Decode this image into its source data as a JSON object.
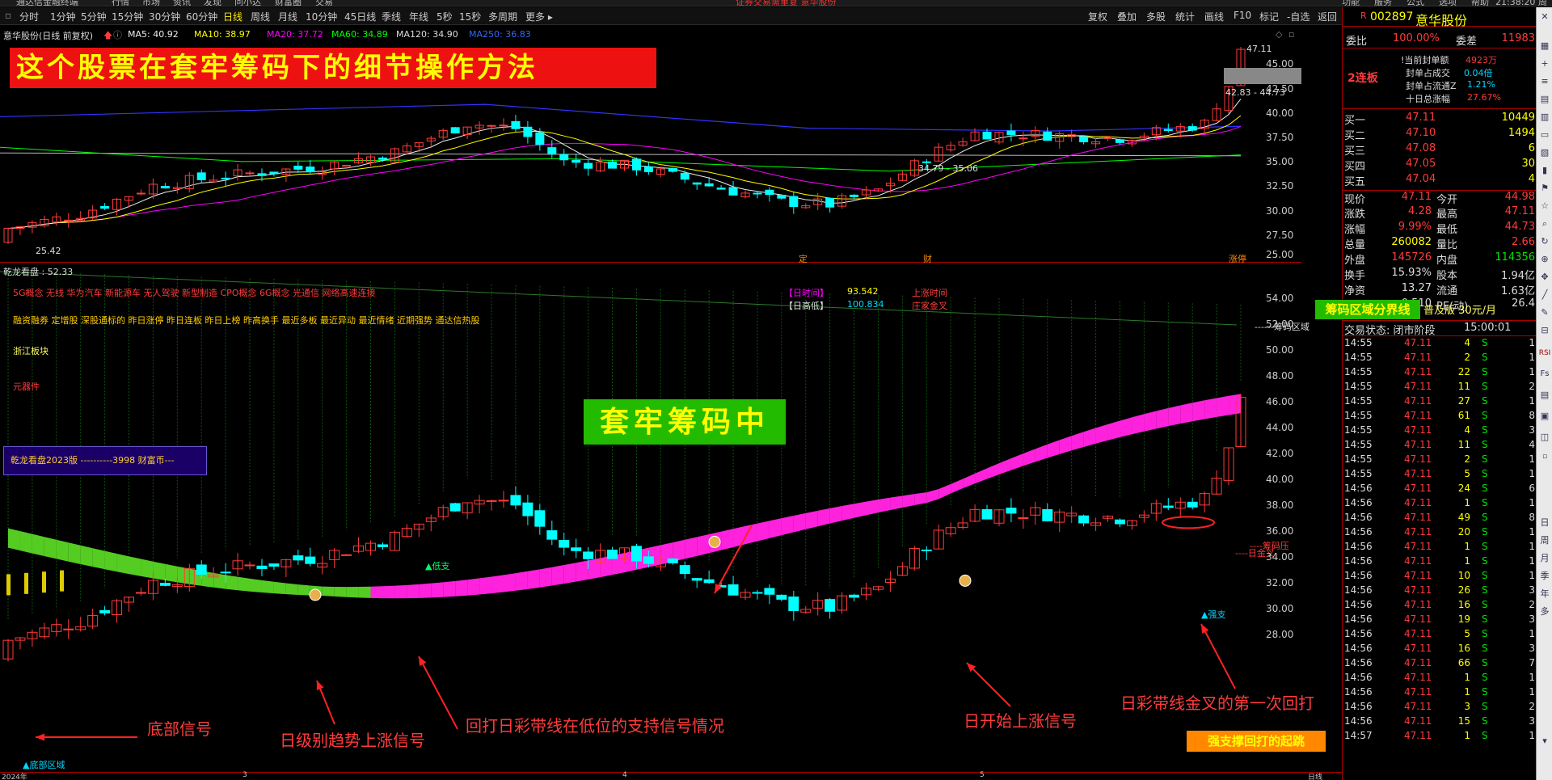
{
  "menubar": {
    "items": [
      "通达信金融终端",
      "行情",
      "市场",
      "资讯",
      "发现",
      "问小达",
      "财富圈",
      "交易"
    ],
    "notice": "证券交易需重复 意华股份",
    "right_items": [
      "功能",
      "服务",
      "公式",
      "选项",
      "帮助"
    ],
    "clock": "21:38:20 周六"
  },
  "toolbar": {
    "periods": [
      "分时",
      "1分钟",
      "5分钟",
      "15分钟",
      "30分钟",
      "60分钟",
      "日线",
      "周线",
      "月线",
      "10分钟",
      "45日线",
      "季线",
      "年线",
      "5秒",
      "15秒",
      "多周期",
      "更多 ▸"
    ],
    "active_period": "日线",
    "right_items": [
      "复权",
      "叠加",
      "多股",
      "统计",
      "画线",
      "F10",
      "标记",
      "-自选",
      "返回"
    ]
  },
  "chart_header": {
    "name": "意华股份(日线 前复权)",
    "ma5": "MA5: 40.92",
    "ma10": "MA10: 38.97",
    "ma20": "MA20: 37.72",
    "ma60": "MA60: 34.89",
    "ma120": "MA120: 34.90",
    "ma250": "MA250: 36.83"
  },
  "banner_top": "这个股票在套牢筹码下的细节操作方法",
  "main_labels": {
    "low": "25.42",
    "high": "47.11",
    "range1": "42.83 - 44.73",
    "range2": "34.79 - 35.06",
    "tag_ding": "定",
    "tag_cai": "财",
    "tag_zhang": "涨停"
  },
  "main_axis": [
    "45.00",
    "42.50",
    "40.00",
    "37.50",
    "35.00",
    "32.50",
    "30.00",
    "27.50",
    "25.00"
  ],
  "indicator": {
    "title": "乾龙看盘 : 52.33",
    "concept_line1": "5G概念 无线 华为汽车 新能源车 无人驾驶 新型制造 CPO概念 6G概念 光通信 网络高速连接",
    "concept_line2": "融资融券 定增股 深股通标的 昨日涨停 昨日连板 昨日上榜 昨高换手 最近多板 最近异动 最近情绪 近期强势 通达信热股",
    "sector": "浙江板块",
    "component": "元器件",
    "day_time_label": "【日时间】",
    "day_time_value": "93.542",
    "day_high_label": "【日高低】",
    "day_high_value": "100.834",
    "rise_time": "上涨时间",
    "dealer_cross": "庄家金叉",
    "version_box": "乾龙看盘2023版 ----------3998 财富币---",
    "chip_zone": "------筹码区域",
    "chip_divider": "筹码区域分界线",
    "chip_pressure": "----筹码压",
    "day_cross": "----日金叉",
    "support_low": "▲低支",
    "support_strong": "▲强支",
    "bottom_zone": "▲底部区域"
  },
  "banner_mid": "套牢筹码中",
  "subscription": "普及版  30元/月",
  "ind_axis": [
    "54.00",
    "52.00",
    "50.00",
    "48.00",
    "46.00",
    "44.00",
    "42.00",
    "40.00",
    "38.00",
    "36.00",
    "34.00",
    "32.00",
    "30.00",
    "28.00"
  ],
  "annotations": {
    "bottom_signal": "底部信号",
    "day_trend_up": "日级别趋势上涨信号",
    "pullback_support": "回打日彩带线在低位的支持信号情况",
    "day_start_up": "日开始上涨信号",
    "first_pullback": "日彩带线金叉的第一次回打",
    "strong_support_start": "强支撑回打的起跳"
  },
  "xaxis": {
    "labels": [
      "2024年",
      "3",
      "4",
      "5"
    ],
    "right": "日线"
  },
  "stock": {
    "code": "002897",
    "name": "意华股份"
  },
  "order_ratio": {
    "label": "委比",
    "ratio": "100.00%",
    "diff_label": "委差",
    "diff": "11983"
  },
  "limit_up": {
    "boards": "2连板",
    "lines": [
      {
        "label": "!当前封单额",
        "value": "4923万"
      },
      {
        "label": "封单占成交",
        "value": "0.04倍"
      },
      {
        "label": "封单占流通Z",
        "value": "1.21%"
      },
      {
        "label": "十日总涨幅",
        "value": "27.67%"
      }
    ]
  },
  "bids": [
    {
      "label": "买一",
      "price": "47.11",
      "vol": "10449"
    },
    {
      "label": "买二",
      "price": "47.10",
      "vol": "1494"
    },
    {
      "label": "买三",
      "price": "47.08",
      "vol": "6"
    },
    {
      "label": "买四",
      "price": "47.05",
      "vol": "30"
    },
    {
      "label": "买五",
      "price": "47.04",
      "vol": "4"
    }
  ],
  "quote": [
    {
      "l1": "现价",
      "v1": "47.11",
      "c1": "red",
      "l2": "今开",
      "v2": "44.98",
      "c2": "red"
    },
    {
      "l1": "涨跌",
      "v1": "4.28",
      "c1": "red",
      "l2": "最高",
      "v2": "47.11",
      "c2": "red"
    },
    {
      "l1": "涨幅",
      "v1": "9.99%",
      "c1": "red",
      "l2": "最低",
      "v2": "44.73",
      "c2": "red"
    },
    {
      "l1": "总量",
      "v1": "260082",
      "c1": "yellow",
      "l2": "量比",
      "v2": "2.66",
      "c2": "red"
    },
    {
      "l1": "外盘",
      "v1": "145726",
      "c1": "red",
      "l2": "内盘",
      "v2": "114356",
      "c2": "green"
    },
    {
      "l1": "换手",
      "v1": "15.93%",
      "c1": "white",
      "l2": "股本",
      "v2": "1.94亿",
      "c2": "white"
    },
    {
      "l1": "净资",
      "v1": "13.27",
      "c1": "white",
      "l2": "流通",
      "v2": "1.63亿",
      "c2": "white"
    },
    {
      "l1": "收益(一)",
      "v1": "0.510",
      "c1": "white",
      "l2": "PE(动)",
      "v2": "26.4",
      "c2": "white"
    }
  ],
  "trade_status": {
    "label": "交易状态: 闭市阶段",
    "time": "15:00:01"
  },
  "ticks": [
    {
      "t": "14:55",
      "p": "47.11",
      "v": "4",
      "s": "S",
      "n": "1"
    },
    {
      "t": "14:55",
      "p": "47.11",
      "v": "2",
      "s": "S",
      "n": "1"
    },
    {
      "t": "14:55",
      "p": "47.11",
      "v": "22",
      "s": "S",
      "n": "1"
    },
    {
      "t": "14:55",
      "p": "47.11",
      "v": "11",
      "s": "S",
      "n": "2"
    },
    {
      "t": "14:55",
      "p": "47.11",
      "v": "27",
      "s": "S",
      "n": "1"
    },
    {
      "t": "14:55",
      "p": "47.11",
      "v": "61",
      "s": "S",
      "n": "8"
    },
    {
      "t": "14:55",
      "p": "47.11",
      "v": "4",
      "s": "S",
      "n": "3"
    },
    {
      "t": "14:55",
      "p": "47.11",
      "v": "11",
      "s": "S",
      "n": "4"
    },
    {
      "t": "14:55",
      "p": "47.11",
      "v": "2",
      "s": "S",
      "n": "1"
    },
    {
      "t": "14:55",
      "p": "47.11",
      "v": "5",
      "s": "S",
      "n": "1"
    },
    {
      "t": "14:56",
      "p": "47.11",
      "v": "24",
      "s": "S",
      "n": "6"
    },
    {
      "t": "14:56",
      "p": "47.11",
      "v": "1",
      "s": "S",
      "n": "1"
    },
    {
      "t": "14:56",
      "p": "47.11",
      "v": "49",
      "s": "S",
      "n": "8"
    },
    {
      "t": "14:56",
      "p": "47.11",
      "v": "20",
      "s": "S",
      "n": "1"
    },
    {
      "t": "14:56",
      "p": "47.11",
      "v": "1",
      "s": "S",
      "n": "1"
    },
    {
      "t": "14:56",
      "p": "47.11",
      "v": "1",
      "s": "S",
      "n": "1"
    },
    {
      "t": "14:56",
      "p": "47.11",
      "v": "10",
      "s": "S",
      "n": "1"
    },
    {
      "t": "14:56",
      "p": "47.11",
      "v": "26",
      "s": "S",
      "n": "3"
    },
    {
      "t": "14:56",
      "p": "47.11",
      "v": "16",
      "s": "S",
      "n": "2"
    },
    {
      "t": "14:56",
      "p": "47.11",
      "v": "19",
      "s": "S",
      "n": "3"
    },
    {
      "t": "14:56",
      "p": "47.11",
      "v": "5",
      "s": "S",
      "n": "1"
    },
    {
      "t": "14:56",
      "p": "47.11",
      "v": "16",
      "s": "S",
      "n": "3"
    },
    {
      "t": "14:56",
      "p": "47.11",
      "v": "66",
      "s": "S",
      "n": "7"
    },
    {
      "t": "14:56",
      "p": "47.11",
      "v": "1",
      "s": "S",
      "n": "1"
    },
    {
      "t": "14:56",
      "p": "47.11",
      "v": "1",
      "s": "S",
      "n": "1"
    },
    {
      "t": "14:56",
      "p": "47.11",
      "v": "3",
      "s": "S",
      "n": "2"
    },
    {
      "t": "14:56",
      "p": "47.11",
      "v": "15",
      "s": "S",
      "n": "3"
    },
    {
      "t": "14:57",
      "p": "47.11",
      "v": "1",
      "s": "S",
      "n": "1"
    }
  ],
  "side_icons": [
    "多",
    "季",
    "年",
    "日",
    "周",
    "月",
    "RSI",
    "Fs"
  ],
  "colors": {
    "up": "#ff3b3b",
    "down": "#00ffff",
    "ribbon_up": "#ff22dd",
    "ribbon_down": "#55cc22",
    "ma5": "#eeeeee",
    "ma10": "#ffff00",
    "ma20": "#ff00ff",
    "ma60": "#00ff00",
    "ma250": "#3333ff"
  }
}
